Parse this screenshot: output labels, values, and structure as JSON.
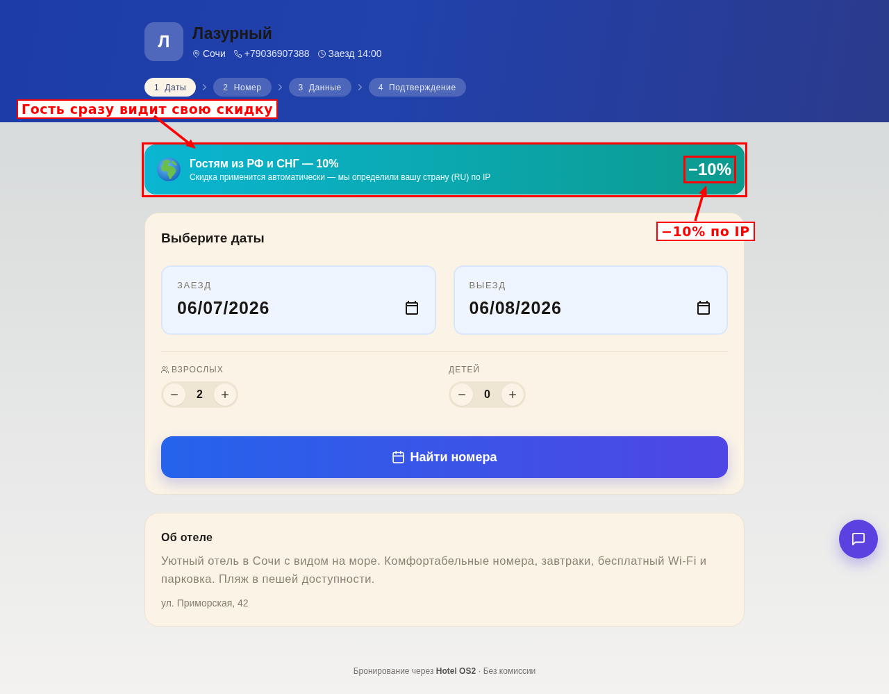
{
  "hotel": {
    "initial": "Л",
    "name": "Лазурный",
    "city": "Сочи",
    "phone": "+79036907388",
    "checkin": "Заезд 14:00"
  },
  "steps": [
    {
      "number": "1",
      "label": "Даты",
      "selected": true
    },
    {
      "number": "2",
      "label": "Номер",
      "selected": false
    },
    {
      "number": "3",
      "label": "Данные",
      "selected": false
    },
    {
      "number": "4",
      "label": "Подтверждение",
      "selected": false
    }
  ],
  "promo": {
    "title": "Гостям из РФ и СНГ — 10%",
    "subtitle": "Скидка применится автоматически — мы определили вашу страну (RU) по IP",
    "discount": "−10%",
    "highlighted": true,
    "discount_highlighted": true
  },
  "booking": {
    "title": "Выберите даты",
    "dates": [
      {
        "label": "ЗАЕЗД",
        "value": "06/07/2026"
      },
      {
        "label": "ВЫЕЗД",
        "value": "06/08/2026"
      }
    ],
    "guests": [
      {
        "kind": "adults",
        "label": "ВЗРОСЛЫХ",
        "value": "2"
      },
      {
        "kind": "children",
        "label": "ДЕТЕЙ",
        "value": "0"
      }
    ],
    "submit": "Найти номера"
  },
  "about": {
    "title": "Об отеле",
    "description": "Уютный отель в Сочи с видом на море. Комфортабельные номера, завтраки, бесплатный Wi-Fi и парковка. Пляж в пешей доступности.",
    "address": "ул. Приморская, 42"
  },
  "footer": "Бронирование через **Hotel OS2** · Без комиссии",
  "annotations": [
    {
      "text": "Гость сразу видит свою скидку"
    },
    {
      "text": "−10% по IP"
    }
  ]
}
